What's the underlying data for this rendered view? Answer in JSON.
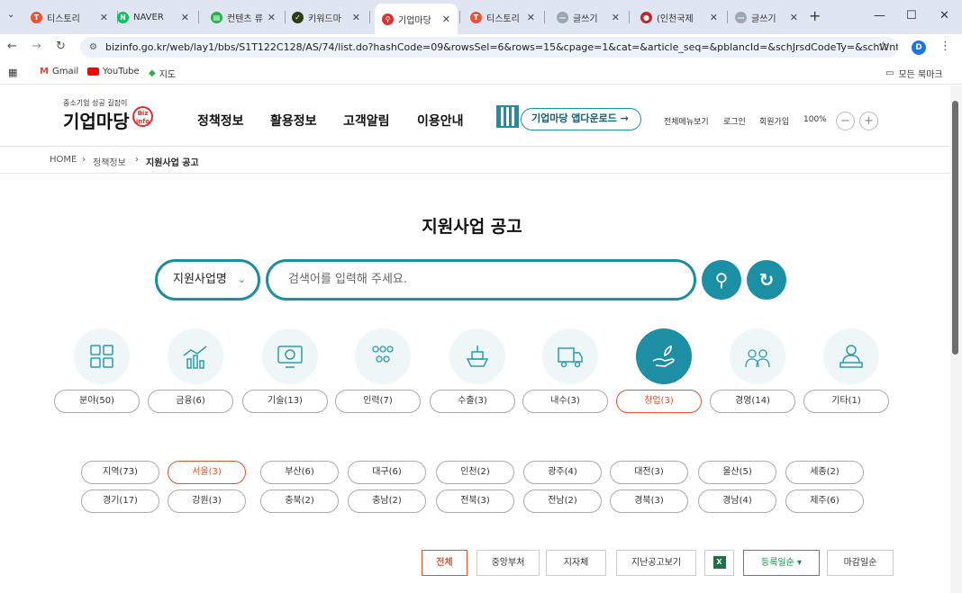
{
  "tabs": [
    {
      "label": "티스토리",
      "icon": "tistory-icon",
      "color": "#ef5135",
      "fav": "T"
    },
    {
      "label": "NAVER",
      "icon": "naver-icon",
      "color": "#03c75a",
      "fav": "N"
    },
    {
      "label": "컨텐츠 류",
      "icon": "content-icon",
      "color": "#24b24a",
      "fav": "▤"
    },
    {
      "label": "키워드마",
      "icon": "keyword-icon",
      "color": "#2b3d13",
      "fav": "✓"
    },
    {
      "label": "기업마당",
      "icon": "search-tab-icon",
      "color": "#e0302b",
      "fav": "⚲"
    },
    {
      "label": "티스토리",
      "icon": "tistory-icon",
      "color": "#ef5135",
      "fav": "T"
    },
    {
      "label": "글쓰기",
      "icon": "write-icon",
      "color": "#9ba7b4",
      "fav": "—"
    },
    {
      "label": "(인천국제",
      "icon": "incheon-icon",
      "color": "#c1272d",
      "fav": "●"
    },
    {
      "label": "글쓰기",
      "icon": "write-icon",
      "color": "#9ba7b4",
      "fav": "—"
    }
  ],
  "url": "bizinfo.go.kr/web/lay1/bbs/S1T122C128/AS/74/list.do?hashCode=09&rowsSel=6&rows=15&cpage=1&cat=&article_seq=&pblancId=&schJrsdCodeTy=&schWntyAt=&sc...",
  "profile_initial": "D",
  "bookmarks": {
    "gmail": "Gmail",
    "youtube": "YouTube",
    "maps": "지도",
    "all": "모든 북마크"
  },
  "logo": {
    "sub": "중소기업 성공 길잡이",
    "name": "기업마당",
    "badge": "Biz info"
  },
  "gnb": [
    "정책정보",
    "활용정보",
    "고객알림",
    "이용안내"
  ],
  "app_download": "기업마당 앱다운로드 →",
  "util": {
    "menu": "전체메뉴보기",
    "login": "로그인",
    "join": "회원가입",
    "zoom": "100%",
    "zoom_out": "−",
    "zoom_in": "+"
  },
  "breadcrumb": {
    "home": "HOME",
    "sep": "›",
    "level1": "정책정보",
    "level2": "지원사업 공고"
  },
  "page_title": "지원사업 공고",
  "search": {
    "select": "지원사업명",
    "placeholder": "검색어를 입력해 주세요.",
    "search_btn": "⚲",
    "reset_btn": "↻"
  },
  "categories": [
    {
      "label": "분야(50)",
      "icon": "grid-icon",
      "active": false
    },
    {
      "label": "금융(6)",
      "icon": "finance-chart-icon",
      "active": false
    },
    {
      "label": "기술(13)",
      "icon": "tech-gear-icon",
      "active": false
    },
    {
      "label": "인력(7)",
      "icon": "people-icon",
      "active": false
    },
    {
      "label": "수출(3)",
      "icon": "ship-icon",
      "active": false
    },
    {
      "label": "내수(3)",
      "icon": "truck-icon",
      "active": false
    },
    {
      "label": "창업(3)",
      "icon": "startup-hand-icon",
      "active": true
    },
    {
      "label": "경영(14)",
      "icon": "management-icon",
      "active": false
    },
    {
      "label": "기타(1)",
      "icon": "person-laptop-icon",
      "active": false
    }
  ],
  "regions_row1": [
    {
      "label": "지역(73)",
      "active": false
    },
    {
      "label": "서울(3)",
      "active": true
    },
    {
      "label": "부산(6)",
      "active": false
    },
    {
      "label": "대구(6)",
      "active": false
    },
    {
      "label": "인천(2)",
      "active": false
    },
    {
      "label": "광주(4)",
      "active": false
    },
    {
      "label": "대전(3)",
      "active": false
    },
    {
      "label": "울산(5)",
      "active": false
    },
    {
      "label": "세종(2)",
      "active": false
    }
  ],
  "regions_row2": [
    {
      "label": "경기(17)",
      "active": false
    },
    {
      "label": "강원(3)",
      "active": false
    },
    {
      "label": "충북(2)",
      "active": false
    },
    {
      "label": "충남(2)",
      "active": false
    },
    {
      "label": "전북(3)",
      "active": false
    },
    {
      "label": "전남(2)",
      "active": false
    },
    {
      "label": "경북(3)",
      "active": false
    },
    {
      "label": "경남(4)",
      "active": false
    },
    {
      "label": "제주(6)",
      "active": false
    }
  ],
  "filter": {
    "all": "전체",
    "central": "중앙부처",
    "local": "지자체",
    "past": "지난공고보기",
    "sort_reg": "등록일순 ▾",
    "sort_end": "마감일순"
  },
  "colors": {
    "teal": "#1b8fa3",
    "orange": "#e2542e",
    "red": "#e0302b"
  }
}
